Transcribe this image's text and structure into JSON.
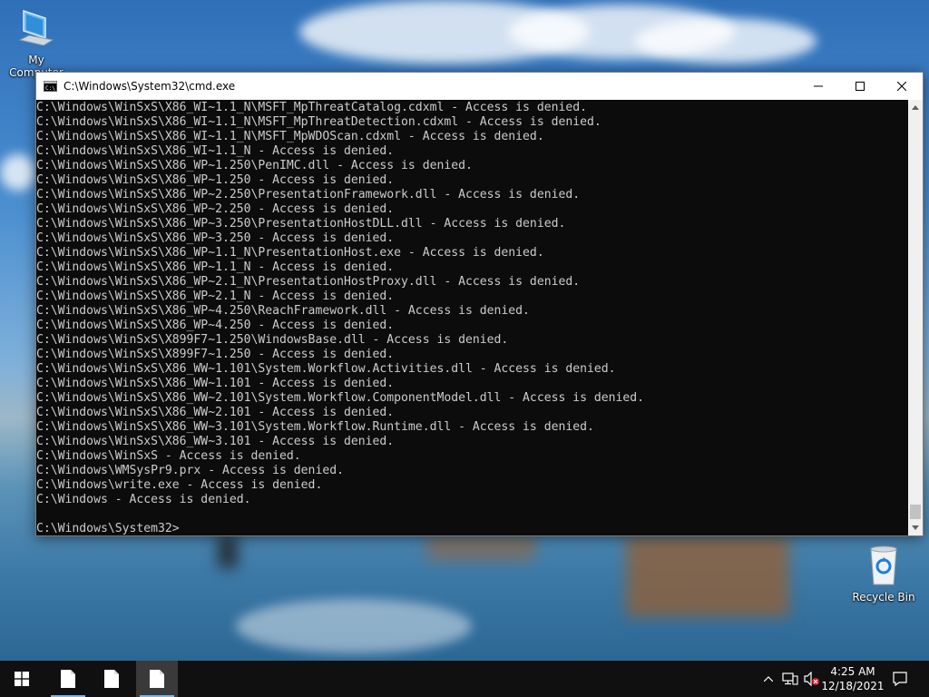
{
  "desktop": {
    "icons": [
      {
        "label": "My Computer",
        "icon": "computer-icon"
      },
      {
        "label": "Recycle Bin",
        "icon": "recycle-bin-icon"
      }
    ]
  },
  "window": {
    "title": "C:\\Windows\\System32\\cmd.exe",
    "controls": {
      "minimize": "minimize-icon",
      "maximize": "maximize-icon",
      "close": "close-icon"
    }
  },
  "console": {
    "lines": [
      "C:\\Windows\\WinSxS\\X86_WI~1.1_N\\MSFT_MpThreatCatalog.cdxml - Access is denied.",
      "C:\\Windows\\WinSxS\\X86_WI~1.1_N\\MSFT_MpThreatDetection.cdxml - Access is denied.",
      "C:\\Windows\\WinSxS\\X86_WI~1.1_N\\MSFT_MpWDOScan.cdxml - Access is denied.",
      "C:\\Windows\\WinSxS\\X86_WI~1.1_N - Access is denied.",
      "C:\\Windows\\WinSxS\\X86_WP~1.250\\PenIMC.dll - Access is denied.",
      "C:\\Windows\\WinSxS\\X86_WP~1.250 - Access is denied.",
      "C:\\Windows\\WinSxS\\X86_WP~2.250\\PresentationFramework.dll - Access is denied.",
      "C:\\Windows\\WinSxS\\X86_WP~2.250 - Access is denied.",
      "C:\\Windows\\WinSxS\\X86_WP~3.250\\PresentationHostDLL.dll - Access is denied.",
      "C:\\Windows\\WinSxS\\X86_WP~3.250 - Access is denied.",
      "C:\\Windows\\WinSxS\\X86_WP~1.1_N\\PresentationHost.exe - Access is denied.",
      "C:\\Windows\\WinSxS\\X86_WP~1.1_N - Access is denied.",
      "C:\\Windows\\WinSxS\\X86_WP~2.1_N\\PresentationHostProxy.dll - Access is denied.",
      "C:\\Windows\\WinSxS\\X86_WP~2.1_N - Access is denied.",
      "C:\\Windows\\WinSxS\\X86_WP~4.250\\ReachFramework.dll - Access is denied.",
      "C:\\Windows\\WinSxS\\X86_WP~4.250 - Access is denied.",
      "C:\\Windows\\WinSxS\\X899F7~1.250\\WindowsBase.dll - Access is denied.",
      "C:\\Windows\\WinSxS\\X899F7~1.250 - Access is denied.",
      "C:\\Windows\\WinSxS\\X86_WW~1.101\\System.Workflow.Activities.dll - Access is denied.",
      "C:\\Windows\\WinSxS\\X86_WW~1.101 - Access is denied.",
      "C:\\Windows\\WinSxS\\X86_WW~2.101\\System.Workflow.ComponentModel.dll - Access is denied.",
      "C:\\Windows\\WinSxS\\X86_WW~2.101 - Access is denied.",
      "C:\\Windows\\WinSxS\\X86_WW~3.101\\System.Workflow.Runtime.dll - Access is denied.",
      "C:\\Windows\\WinSxS\\X86_WW~3.101 - Access is denied.",
      "C:\\Windows\\WinSxS - Access is denied.",
      "C:\\Windows\\WMSysPr9.prx - Access is denied.",
      "C:\\Windows\\write.exe - Access is denied.",
      "C:\\Windows - Access is denied.",
      "",
      "C:\\Windows\\System32>"
    ]
  },
  "taskbar": {
    "start": "windows-start-icon",
    "apps": [
      "file-icon",
      "file-icon",
      "file-icon"
    ],
    "tray": [
      "chevron-up-icon",
      "network-icon",
      "volume-muted-icon"
    ],
    "time": "4:25 AM",
    "date": "12/18/2021",
    "notifications": "notification-icon"
  },
  "colors": {
    "console_bg": "#0c0c0c",
    "console_text": "#cccccc",
    "taskbar_bg": "#101010",
    "active_underline": "#76b9ed"
  }
}
